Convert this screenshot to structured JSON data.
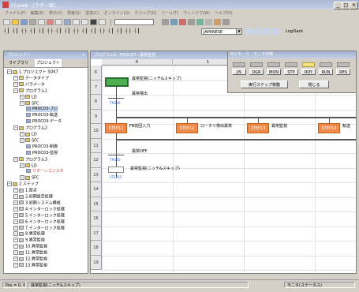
{
  "window": {
    "title": "FCoreA - [ラダー図]"
  },
  "menubar": {
    "items": [
      "ファイル(F)",
      "編集(E)",
      "表示(V)",
      "検索(S)",
      "変換(C)",
      "オンライン(O)",
      "デバッグ(D)",
      "ツール(T)",
      "ウィンドウ(W)",
      "ヘルプ(H)"
    ]
  },
  "toolbar": {
    "combo_value": "JAPANESE",
    "logic_label": "LogiSack"
  },
  "project": {
    "title": "プロジェクト",
    "tabs": [
      "ライブラリ",
      "プロジェクト"
    ],
    "tree": [
      {
        "label": "1.プロジェクト SDK7",
        "depth": 0,
        "icon": "folder-icon"
      },
      {
        "label": "データタイプ",
        "depth": 1,
        "icon": "folder-icon"
      },
      {
        "label": "パラメータ",
        "depth": 1,
        "icon": "folder-icon"
      },
      {
        "label": "プログラム1",
        "depth": 1,
        "icon": "folder-icon"
      },
      {
        "label": "LD",
        "depth": 2,
        "icon": "folder-icon"
      },
      {
        "label": "SFC",
        "depth": 2,
        "icon": "folder-icon"
      },
      {
        "label": "PROC03-ブロ",
        "depth": 3,
        "icon": "pou-icon",
        "selected": true
      },
      {
        "label": "PROC03-転送",
        "depth": 3,
        "icon": "pou-icon"
      },
      {
        "label": "PROC03-データ",
        "depth": 3,
        "icon": "pou-icon"
      },
      {
        "label": "プログラム2",
        "depth": 1,
        "icon": "folder-icon"
      },
      {
        "label": "LD",
        "depth": 2,
        "icon": "folder-icon"
      },
      {
        "label": "SFC",
        "depth": 2,
        "icon": "folder-icon"
      },
      {
        "label": "PROC03-制御",
        "depth": 3,
        "icon": "pou-icon"
      },
      {
        "label": "PROC03-監視",
        "depth": 3,
        "icon": "pou-icon"
      },
      {
        "label": "プログラム3",
        "depth": 1,
        "icon": "folder-icon"
      },
      {
        "label": "LD",
        "depth": 2,
        "icon": "folder-icon"
      },
      {
        "label": "リターンコンスタ",
        "depth": 3,
        "icon": "pou-icon",
        "red": true
      },
      {
        "label": "SFC",
        "depth": 2,
        "icon": "folder-icon"
      },
      {
        "label": "2.ステップ",
        "depth": 0,
        "icon": "folder-icon"
      },
      {
        "label": "1.原点",
        "depth": 1,
        "icon": "step-icon"
      },
      {
        "label": "2.初期設定処理",
        "depth": 1,
        "icon": "step-icon"
      },
      {
        "label": "3.初期システム構成",
        "depth": 1,
        "icon": "step-icon"
      },
      {
        "label": "4.インターロック処理",
        "depth": 1,
        "icon": "step-icon"
      },
      {
        "label": "5.インターロック処理",
        "depth": 1,
        "icon": "step-icon"
      },
      {
        "label": "6.インターロック処理",
        "depth": 1,
        "icon": "step-icon"
      },
      {
        "label": "7.インターロック処理",
        "depth": 1,
        "icon": "step-icon"
      },
      {
        "label": "8.異常処理",
        "depth": 1,
        "icon": "step-icon"
      },
      {
        "label": "9.異常監視",
        "depth": 1,
        "icon": "step-icon"
      },
      {
        "label": "10.異常監視",
        "depth": 1,
        "icon": "step-icon"
      },
      {
        "label": "11.異常監視",
        "depth": 1,
        "icon": "step-icon"
      },
      {
        "label": "12.異常監視",
        "depth": 1,
        "icon": "step-icon"
      },
      {
        "label": "13.異常監視",
        "depth": 1,
        "icon": "step-icon"
      }
    ]
  },
  "ladder": {
    "title": "プログラム1 - PROC03 - 異常監視",
    "col_headers": [
      "0",
      "1",
      "2",
      "3"
    ],
    "rows": [
      "6",
      "7",
      "8",
      "9",
      "10",
      "11",
      "12",
      "13",
      "14",
      "15",
      "16",
      "17",
      "18",
      "19"
    ],
    "top_step": {
      "label": "STEP10",
      "text": "異常監視(ニッチ&スキップ)"
    },
    "top_contact": {
      "label": "異常検出",
      "sub": "TM130"
    },
    "blocks": [
      {
        "label": "STEP11",
        "text": "FB前回入力"
      },
      {
        "label": "STEP12",
        "text": "ロータリ検出異常"
      },
      {
        "label": "STEP13",
        "text": "異常監視"
      },
      {
        "label": "STEP14",
        "text": "転送"
      }
    ],
    "bottom_contact": {
      "label": "異常OFF",
      "sub": "TM150"
    },
    "bottom_step": {
      "label": "STEP20",
      "text": "異常監視(ニッチ&スキップ)"
    }
  },
  "monitor": {
    "title": "PLCモード - モニタ状態",
    "leds": [
      {
        "label": "JIS",
        "on": false
      },
      {
        "label": "DGR",
        "on": false
      },
      {
        "label": "MON",
        "on": false
      },
      {
        "label": "STP",
        "on": false
      },
      {
        "label": "RDY",
        "on": true
      },
      {
        "label": "RUN",
        "on": false
      },
      {
        "label": "RES",
        "on": false
      }
    ],
    "actions": {
      "go": "実行ステップ移動",
      "close": "閉じる"
    }
  },
  "statusbar": {
    "position": "Pos = 0, 0",
    "message": "異常監視(ニッチ&スキップ)",
    "mode": "モニタ(ステータス)"
  }
}
